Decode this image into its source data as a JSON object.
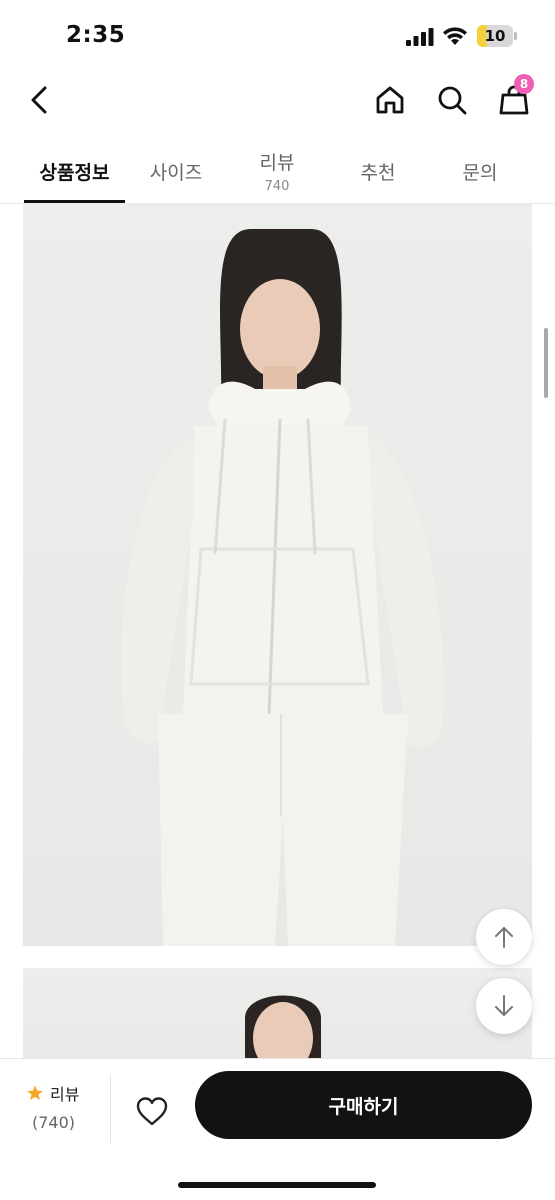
{
  "status_bar": {
    "time": "2:35",
    "battery_level": "10",
    "battery_fraction": 0.1
  },
  "header": {
    "icons": [
      "back-icon",
      "home-icon",
      "search-icon",
      "shopping-bag-icon"
    ],
    "cart_badge": "8",
    "badge_color": "#ee5fb3"
  },
  "tabs": [
    {
      "label": "상품정보",
      "count": "",
      "active": true
    },
    {
      "label": "사이즈",
      "count": ""
    },
    {
      "label": "리뷰",
      "count": "740"
    },
    {
      "label": "추천",
      "count": ""
    },
    {
      "label": "문의",
      "count": ""
    }
  ],
  "content": {
    "images": [
      "product-photo-white-zip-hoodie-full",
      "product-photo-white-zip-hoodie-partial"
    ]
  },
  "floating_buttons": {
    "icons": [
      "arrow-up-icon",
      "arrow-down-icon"
    ]
  },
  "bottom_bar": {
    "review_label": "리뷰",
    "review_count": "(740)",
    "star_color": "#f5a623",
    "buy_label": "구매하기",
    "buy_button_color": "#121212"
  }
}
